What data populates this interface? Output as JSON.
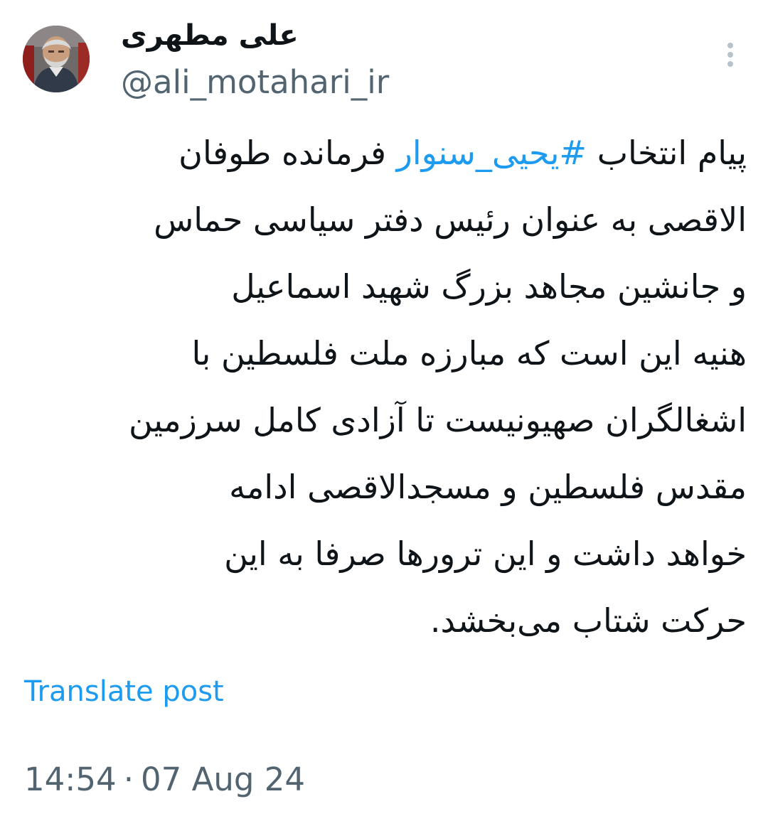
{
  "author": {
    "display_name": "علی مطهری",
    "handle": "@ali_motahari_ir",
    "avatar_icon": "profile-photo-avatar"
  },
  "post": {
    "lines": [
      {
        "before": "پیام انتخاب ",
        "hashtag": "#یحیی_سنوار",
        "after": " فرمانده طوفان"
      },
      {
        "text": "الاقصی به عنوان رئیس دفتر سیاسی حماس"
      },
      {
        "text": "و جانشین مجاهد بزرگ شهید اسماعیل"
      },
      {
        "text": "هنیه این است که مبارزه ملت فلسطین با"
      },
      {
        "text": "اشغالگران صهیونیست تا آزادی کامل سرزمین"
      },
      {
        "text": "مقدس فلسطین و مسجدالاقصی ادامه"
      },
      {
        "text": "خواهد داشت و این ترورها صرفا به این"
      },
      {
        "text": "حرکت شتاب می‌بخشد."
      }
    ]
  },
  "actions": {
    "more_icon": "vertical-ellipsis-icon",
    "translate_label": "Translate post"
  },
  "meta": {
    "time": "14:54",
    "separator": "·",
    "date": "07 Aug 24"
  },
  "colors": {
    "text_primary": "#0f1419",
    "text_secondary": "#536471",
    "accent": "#1d9bf0",
    "more_icon": "#b8c2ca",
    "background": "#ffffff"
  }
}
